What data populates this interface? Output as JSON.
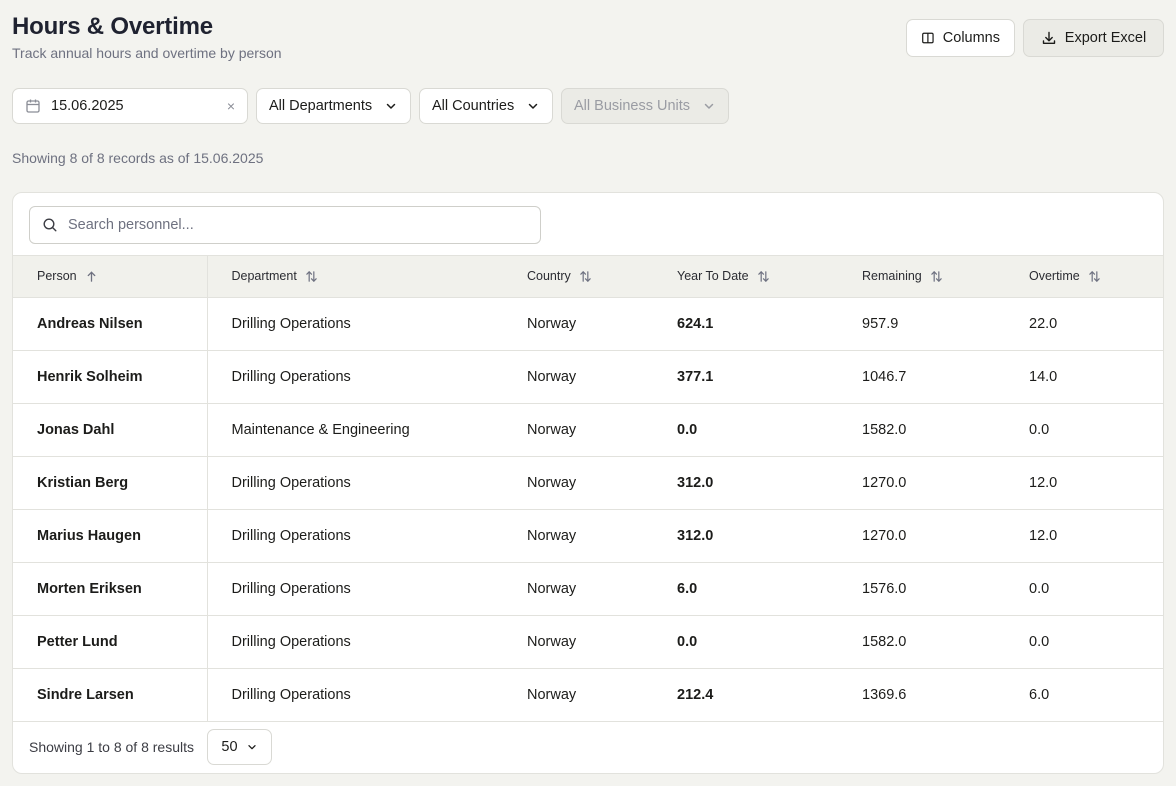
{
  "header": {
    "title": "Hours & Overtime",
    "subtitle": "Track annual hours and overtime by person"
  },
  "toolbar": {
    "columns_label": "Columns",
    "export_label": "Export Excel"
  },
  "filters": {
    "date_value": "15.06.2025",
    "clear_label": "×",
    "department": "All Departments",
    "country": "All Countries",
    "business_unit": "All Business Units"
  },
  "records_text": "Showing 8 of 8 records as of 15.06.2025",
  "search": {
    "placeholder": "Search personnel..."
  },
  "table": {
    "columns": [
      "Person",
      "Department",
      "Country",
      "Year To Date",
      "Remaining",
      "Overtime"
    ],
    "rows": [
      [
        "Andreas Nilsen",
        "Drilling Operations",
        "Norway",
        "624.1",
        "957.9",
        "22.0"
      ],
      [
        "Henrik Solheim",
        "Drilling Operations",
        "Norway",
        "377.1",
        "1046.7",
        "14.0"
      ],
      [
        "Jonas Dahl",
        "Maintenance & Engineering",
        "Norway",
        "0.0",
        "1582.0",
        "0.0"
      ],
      [
        "Kristian Berg",
        "Drilling Operations",
        "Norway",
        "312.0",
        "1270.0",
        "12.0"
      ],
      [
        "Marius Haugen",
        "Drilling Operations",
        "Norway",
        "312.0",
        "1270.0",
        "12.0"
      ],
      [
        "Morten Eriksen",
        "Drilling Operations",
        "Norway",
        "6.0",
        "1576.0",
        "0.0"
      ],
      [
        "Petter Lund",
        "Drilling Operations",
        "Norway",
        "0.0",
        "1582.0",
        "0.0"
      ],
      [
        "Sindre Larsen",
        "Drilling Operations",
        "Norway",
        "212.4",
        "1369.6",
        "6.0"
      ]
    ]
  },
  "footer": {
    "results_text": "Showing 1 to 8 of 8 results",
    "page_size": "50"
  }
}
